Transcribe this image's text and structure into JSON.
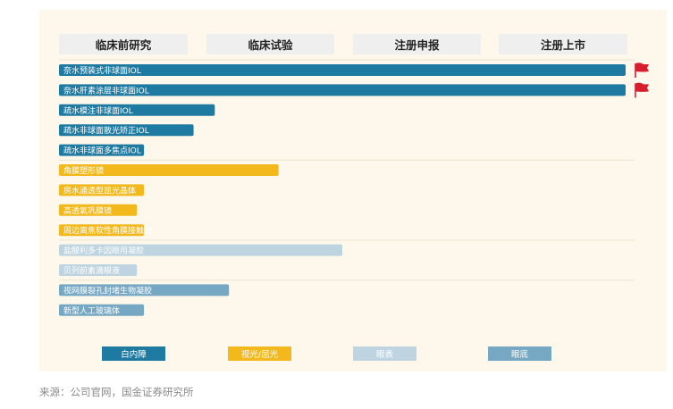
{
  "stages": [
    "临床前研究",
    "临床试验",
    "注册申报",
    "注册上市"
  ],
  "legend": [
    {
      "label": "白内障",
      "color": "#1f7aa2"
    },
    {
      "label": "视光/屈光",
      "color": "#f3b81c"
    },
    {
      "label": "眼表",
      "color": "#bed4e0"
    },
    {
      "label": "眼底",
      "color": "#76a8c4"
    }
  ],
  "source": "来源：公司官网，国金证券研究所",
  "chart_data": {
    "type": "bar",
    "orientation": "horizontal",
    "xlim": [
      0,
      4
    ],
    "categories": [
      "奈水预装式非球面IOL",
      "奈水肝素涂层非球面IOL",
      "疏水模注非球面IOL",
      "疏水非球面散光矫正IOL",
      "疏水非球面多焦点IOL",
      "角膜塑形镜",
      "房水通透型屈光晶体",
      "高透氧巩膜镜",
      "周边离焦软性角膜接触镜",
      "盐酸利多卡因眼用凝胶",
      "贝列前素滴眼液",
      "视网膜裂孔封堵生物凝胶",
      "新型人工玻璃体"
    ],
    "values": [
      4.0,
      4.0,
      1.1,
      0.95,
      0.6,
      1.55,
      0.6,
      0.55,
      0.6,
      2.0,
      0.55,
      1.2,
      0.6
    ],
    "groups": [
      "白内障",
      "白内障",
      "白内障",
      "白内障",
      "白内障",
      "视光/屈光",
      "视光/屈光",
      "视光/屈光",
      "视光/屈光",
      "眼表",
      "眼表",
      "眼底",
      "眼底"
    ],
    "flag_marked": [
      true,
      true,
      false,
      false,
      false,
      false,
      false,
      false,
      false,
      false,
      false,
      false,
      false
    ]
  }
}
